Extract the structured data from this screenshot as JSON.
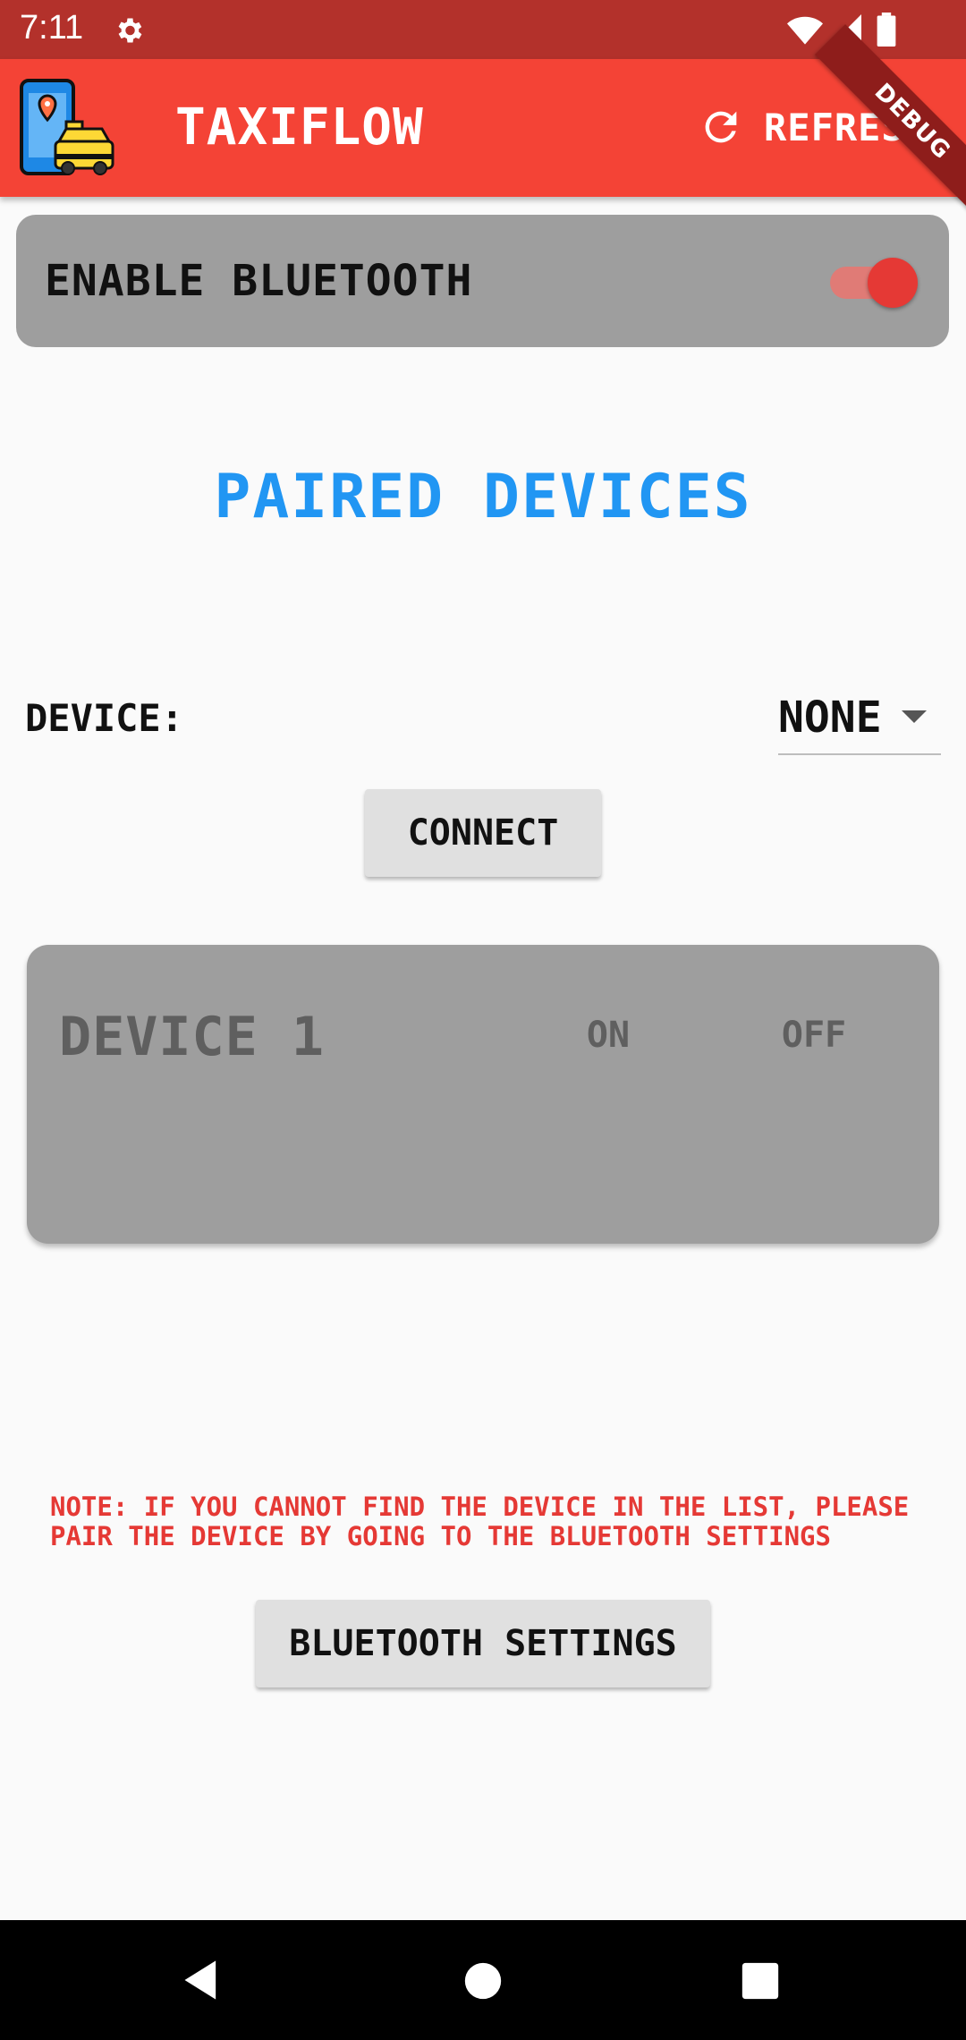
{
  "status_bar": {
    "time": "7:11",
    "icons": [
      "gear-icon",
      "wifi-icon",
      "signal-icon",
      "battery-icon"
    ]
  },
  "app_bar": {
    "title": "TAXIFLOW",
    "refresh_label": "REFRESH",
    "debug_banner": "DEBUG",
    "color": "#f44336"
  },
  "bluetooth": {
    "enable_label": "ENABLE BLUETOOTH",
    "enabled": true
  },
  "paired": {
    "title": "PAIRED DEVICES",
    "device_label": "DEVICE:",
    "selected_device": "NONE",
    "connect_label": "CONNECT"
  },
  "device_card": {
    "name": "DEVICE 1",
    "on_label": "ON",
    "off_label": "OFF"
  },
  "note": "NOTE: IF YOU CANNOT FIND THE DEVICE IN THE LIST, PLEASE PAIR THE DEVICE BY GOING TO THE BLUETOOTH SETTINGS",
  "settings_button_label": "BLUETOOTH SETTINGS",
  "colors": {
    "accent": "#2196f3",
    "warning": "#e53935",
    "card": "#9e9e9e"
  }
}
